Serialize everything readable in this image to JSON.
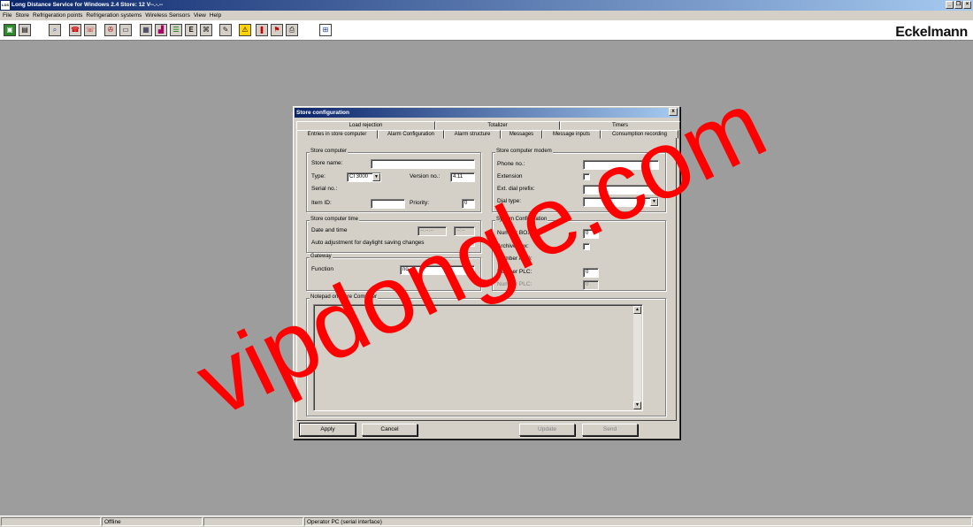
{
  "app": {
    "title": "Long Distance Service for Windows 2.4    Store: 12 V--.-.--",
    "icon_text": "LDS",
    "brand": "Eckelmann"
  },
  "menu": [
    "File",
    "Store",
    "Refrigeration points",
    "Refrigeration systems",
    "Wireless Sensors",
    "View",
    "Help"
  ],
  "toolbar": {
    "icons": [
      "save-icon",
      "open-icon",
      "search-icon",
      "phone-icon",
      "hangup-icon",
      "connect-icon",
      "monitor-icon",
      "table-icon",
      "chart-icon",
      "list-icon",
      "book-icon",
      "tag-icon",
      "message-icon",
      "warning-icon",
      "alarm-icon",
      "history-icon",
      "printer-icon",
      "network-icon"
    ]
  },
  "dialog": {
    "title": "Store configuration",
    "close_label": "x",
    "tabs_top": [
      "Load rejection",
      "Totalizer",
      "Timers"
    ],
    "tabs_bottom": [
      "Entries in store computer",
      "Alarm Configuration",
      "Alarm structure",
      "Messages",
      "Message inputs",
      "Consumption recording"
    ],
    "active_tab": "Entries in store computer",
    "store_computer": {
      "legend": "Store computer",
      "store_name_label": "Store name:",
      "store_name_value": "",
      "type_label": "Type:",
      "type_value": "CI 3000",
      "version_label": "Version no.:",
      "version_value": "4.11",
      "serial_label": "Serial no.:",
      "item_id_label": "Item ID:",
      "item_id_value": "",
      "priority_label": "Priority:",
      "priority_value": "0"
    },
    "store_computer_time": {
      "legend": "Store computer time",
      "date_time_label": "Date and time",
      "date_value": "--.--.--",
      "time_value": "--:--",
      "auto_adjust_label": "Auto adjustment for daylight saving changes"
    },
    "gateway": {
      "legend": "Gateway",
      "function_label": "Function",
      "function_value": "no"
    },
    "modem": {
      "legend": "Store computer modem",
      "phone_label": "Phone no.:",
      "phone_value": "",
      "extension_label": "Extension",
      "ext_dial_label": "Ext. dial prefix:",
      "ext_dial_value": "",
      "dial_type_label": "Dial type:",
      "dial_type_value": ""
    },
    "system_config": {
      "legend": "System Configuration",
      "number_box_label": "Number BOX:",
      "number_box_value": "0",
      "archive_label": "Archive box:",
      "number_a_label": "Number A(D):",
      "number_plc_label": "Number PLC:",
      "number_plc_value": "0",
      "number_plc2_label": "Number PLC:",
      "number_plc2_value": "0"
    },
    "notepad": {
      "legend": "Notepad on Store Computer",
      "value": ""
    },
    "buttons": {
      "apply": "Apply",
      "cancel": "Cancel",
      "update": "Update",
      "send": "Send"
    }
  },
  "status": {
    "panel1": "",
    "connection": "Offline",
    "panel3": "",
    "interface": "Operator PC (serial interface)"
  },
  "watermark": {
    "text": "vipdongle.com",
    "color": "#ff0000"
  }
}
